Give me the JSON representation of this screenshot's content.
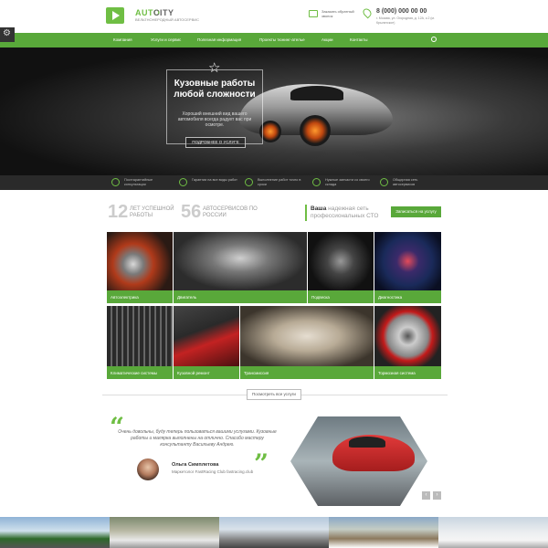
{
  "header": {
    "logo_auto": "AUTO",
    "logo_city": "CITY",
    "logo_sub": "ВЕЛЬТНОНЕРОДНЫЙ АВТОСЕРВИС",
    "callback_text": "Заказать обратный звонок",
    "phone": "8 (000) 000 00 00",
    "address": "г. Москва, ул. Огородная, д. 12А, к.2 (м. Крылатское)"
  },
  "nav": {
    "items": [
      "Компания",
      "Услуги и сервис",
      "Полезная информация",
      "Проекты тюнинг-ателье",
      "Акции",
      "Контакты"
    ]
  },
  "hero": {
    "title": "Кузовные работы любой сложности",
    "text": "Хороший внешний вид вашего автомобиля всегда радует вас при осмотре.",
    "button": "ПОДРОБНЕЕ О УСЛУГЕ"
  },
  "features": [
    "Постгарантийные консультации",
    "Гарантии на все виды работ",
    "Выполнение работ точно в сроки",
    "Нужные запчасти со своего склада",
    "Общирная сеть автосервисов"
  ],
  "stats": [
    {
      "num": "12",
      "label": "ЛЕТ УСПЕШНОЙ РАБОТЫ"
    },
    {
      "num": "56",
      "label": "АВТОСЕРВИСОВ ПО РОССИИ"
    }
  ],
  "network": {
    "bold": "Ваша",
    "text": "надежная сеть профессиональных СТО"
  },
  "cta_button": "Записаться на услугу",
  "services": [
    "Автоэлектрика",
    "Двигатель",
    "Подвеска",
    "Диагностика",
    "Климатические системы",
    "Кузовной ремонт",
    "Трансмиссия",
    "Тормозная система"
  ],
  "all_services_button": "Посмотреть все услуги",
  "testimonial": {
    "text": "Очень довольны, буду теперь пользоваться вашими услугами. Кузовные работы и малярка выполнены на отлично. Спасибо мастеру консультанту Васильеву Андрею.",
    "author": "Ольга Симплетова",
    "author_sub": "Маркетолог FastRacing Club fastracing.club"
  },
  "arrows": {
    "prev": "‹",
    "next": "›"
  }
}
